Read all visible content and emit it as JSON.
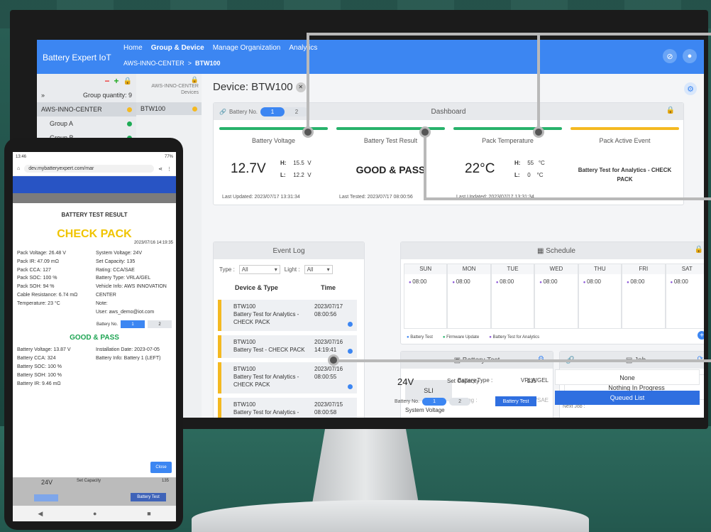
{
  "app": {
    "brand": "Battery Expert IoT",
    "nav": [
      "Home",
      "Group & Device",
      "Manage Organization",
      "Analytics"
    ],
    "active_nav": "Group & Device",
    "breadcrumb_root": "AWS-INNO-CENTER",
    "breadcrumb_sep": ">",
    "breadcrumb_current": "BTW100"
  },
  "sidebar": {
    "group_label": "Group quantity: 9",
    "expand": "»",
    "org": "AWS-INNO-CENTER",
    "groups": [
      "Group A",
      "Group B"
    ],
    "dev_header_line1": "AWS-INNO-CENTER",
    "dev_header_line2": "Devices",
    "device": "BTW100"
  },
  "device": {
    "title": "Device: BTW100"
  },
  "dashboard": {
    "title": "Dashboard",
    "battery_no_label": "Battery No.",
    "battery_tabs": [
      "1",
      "2"
    ],
    "voltage": {
      "title": "Battery Voltage",
      "value": "12.7V",
      "h_label": "H:",
      "h": "15.5",
      "l_label": "L:",
      "l": "12.2",
      "unit": "V",
      "updated": "Last Updated: 2023/07/17 13:31:34"
    },
    "result": {
      "title": "Battery Test Result",
      "value": "GOOD & PASS",
      "tested": "Last Tested: 2023/07/17 08:00:56"
    },
    "temp": {
      "title": "Pack Temperature",
      "value": "22°C",
      "h_label": "H:",
      "h": "55",
      "l_label": "L:",
      "l": "0",
      "unit": "°C",
      "updated": "Last Updated: 2023/07/17 13:31:34"
    },
    "event": {
      "title": "Pack Active Event",
      "value": "Battery Test for Analytics - CHECK PACK"
    }
  },
  "event_log": {
    "title": "Event Log",
    "type_label": "Type :",
    "type_value": "All",
    "light_label": "Light :",
    "light_value": "All",
    "col_device": "Device & Type",
    "col_time": "Time",
    "items": [
      {
        "device": "BTW100",
        "type": "Battery Test for Analytics - CHECK PACK",
        "date": "2023/07/17",
        "time": "08:00:56"
      },
      {
        "device": "BTW100",
        "type": "Battery Test - CHECK PACK",
        "date": "2023/07/16",
        "time": "14:19:41"
      },
      {
        "device": "BTW100",
        "type": "Battery Test for Analytics - CHECK PACK",
        "date": "2023/07/16",
        "time": "08:00:55"
      },
      {
        "device": "BTW100",
        "type": "Battery Test for Analytics - CHECK PACK",
        "date": "2023/07/15",
        "time": "08:00:58"
      }
    ]
  },
  "schedule": {
    "title": "Schedule",
    "days": [
      "SUN",
      "MON",
      "TUE",
      "WED",
      "THU",
      "FRI",
      "SAT"
    ],
    "time": "08:00",
    "legend": [
      "Battery Test",
      "Firmware Update",
      "Battery Test for Analytics"
    ]
  },
  "battery_test": {
    "title": "Battery Test",
    "type_btn": "SLI",
    "battery_type_label": "Battery Type :",
    "battery_type": "VRLA/GEL",
    "rating_label": "Rating :",
    "rating": "CCA/SAE",
    "set_capacity_label": "Set Capacity :",
    "set_capacity": "135",
    "system_voltage_label": "System Voltage",
    "system_voltage": "24V",
    "battery_no_label": "Battery No.",
    "tabs": [
      "1",
      "2"
    ],
    "button": "Battery Test"
  },
  "job": {
    "title": "Job",
    "status": "Nothing In Progress",
    "next_label": "Next Job :",
    "next": "None",
    "queued": "Queued List"
  },
  "phone": {
    "clock": "13:46",
    "battery": "77%",
    "url": "dev.mybatteryexpert.com/mar",
    "title": "BATTERY TEST RESULT",
    "verdict": "CHECK PACK",
    "date": "2023/07/16 14:19:35",
    "left": [
      "Pack Voltage: 26.48 V",
      "Pack IR: 47.09 mΩ",
      "Pack CCA: 127",
      "Pack SOC: 100 %",
      "Pack SOH: 94 %",
      "Cable Resistance: 6.74 mΩ",
      "Temperature: 23 °C"
    ],
    "right": [
      "System Voltage: 24V",
      "Set Capacity: 135",
      "Rating: CCA/SAE",
      "Battery Type: VRLA/GEL",
      "Vehicle Info: AWS INNOVATION CENTER",
      "Note:",
      "User: aws_demo@iot.com"
    ],
    "battery_no_label": "Battery No.",
    "tabs": [
      "1",
      "2"
    ],
    "good": "GOOD & PASS",
    "left2": [
      "Battery Voltage: 13.87 V",
      "Battery CCA: 324",
      "Battery SOC: 100 %",
      "Battery SOH: 100 %",
      "Battery IR: 9.46 mΩ"
    ],
    "right2": [
      "Installation Date: 2023-07-05",
      "Battery Info: Battery 1 (LEFT)"
    ],
    "close": "Close",
    "bg_voltage": "24V",
    "bg_capacity": "Set Capacity",
    "bg_capacity_val": "135",
    "bg_btn": "Battery Test"
  }
}
